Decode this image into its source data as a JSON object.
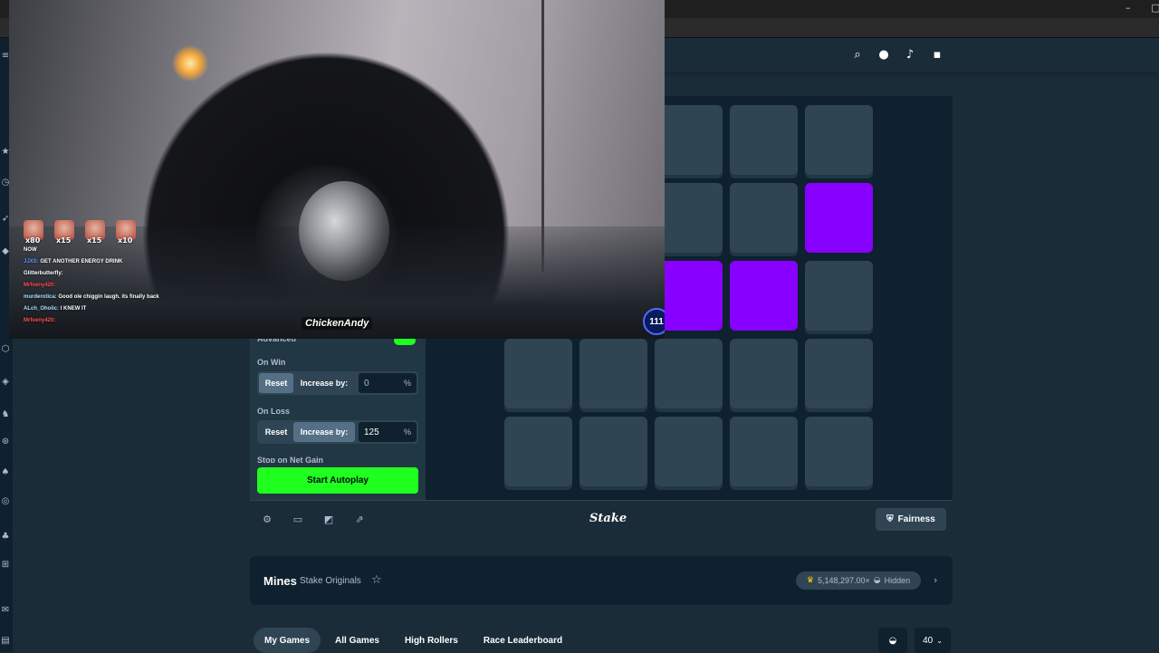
{
  "header": {
    "icons": [
      "search-icon",
      "user-icon",
      "bell-icon",
      "chat-icon"
    ]
  },
  "stream": {
    "emote_counts": [
      "x80",
      "x15",
      "x15",
      "x10"
    ],
    "chat": [
      {
        "user": "NOW",
        "text": ""
      },
      {
        "user": "JJXS:",
        "text": "GET ANOTHER ENERGY DRINK"
      },
      {
        "user": "Glitterbutterfly:",
        "text": ""
      },
      {
        "user": "Mrfoeny420:",
        "text": ""
      },
      {
        "user": "murderotica:",
        "text": "Good ole chiggin laugh. its finally back"
      },
      {
        "user": "ALch_Oholic:",
        "text": "I KNEW IT"
      },
      {
        "user": "Mrfoeny420:",
        "text": ""
      }
    ],
    "streamer": "ChickenAndy",
    "viewer_badge": "111"
  },
  "sidebar": {
    "advanced_label": "Advanced",
    "on_win_label": "On Win",
    "on_loss_label": "On Loss",
    "stop_label": "Stop on Net Gain",
    "reset_label": "Reset",
    "increase_label": "Increase by:",
    "on_win_value": "0",
    "on_loss_value": "125",
    "pct": "%",
    "start_autoplay": "Start Autoplay"
  },
  "footer": {
    "logo": "Stake",
    "fairness": "Fairness"
  },
  "info": {
    "title": "Mines",
    "subtitle": "Stake Originals",
    "max_win": "5,148,297.00×",
    "hidden_label": "Hidden"
  },
  "tabs": [
    "My Games",
    "All Games",
    "High Rollers",
    "Race Leaderboard"
  ],
  "page_size": "40",
  "colors": {
    "gem": "#8800ff",
    "tile": "#2f4553",
    "start": "#1fff20",
    "bg": "#1a2c38"
  }
}
